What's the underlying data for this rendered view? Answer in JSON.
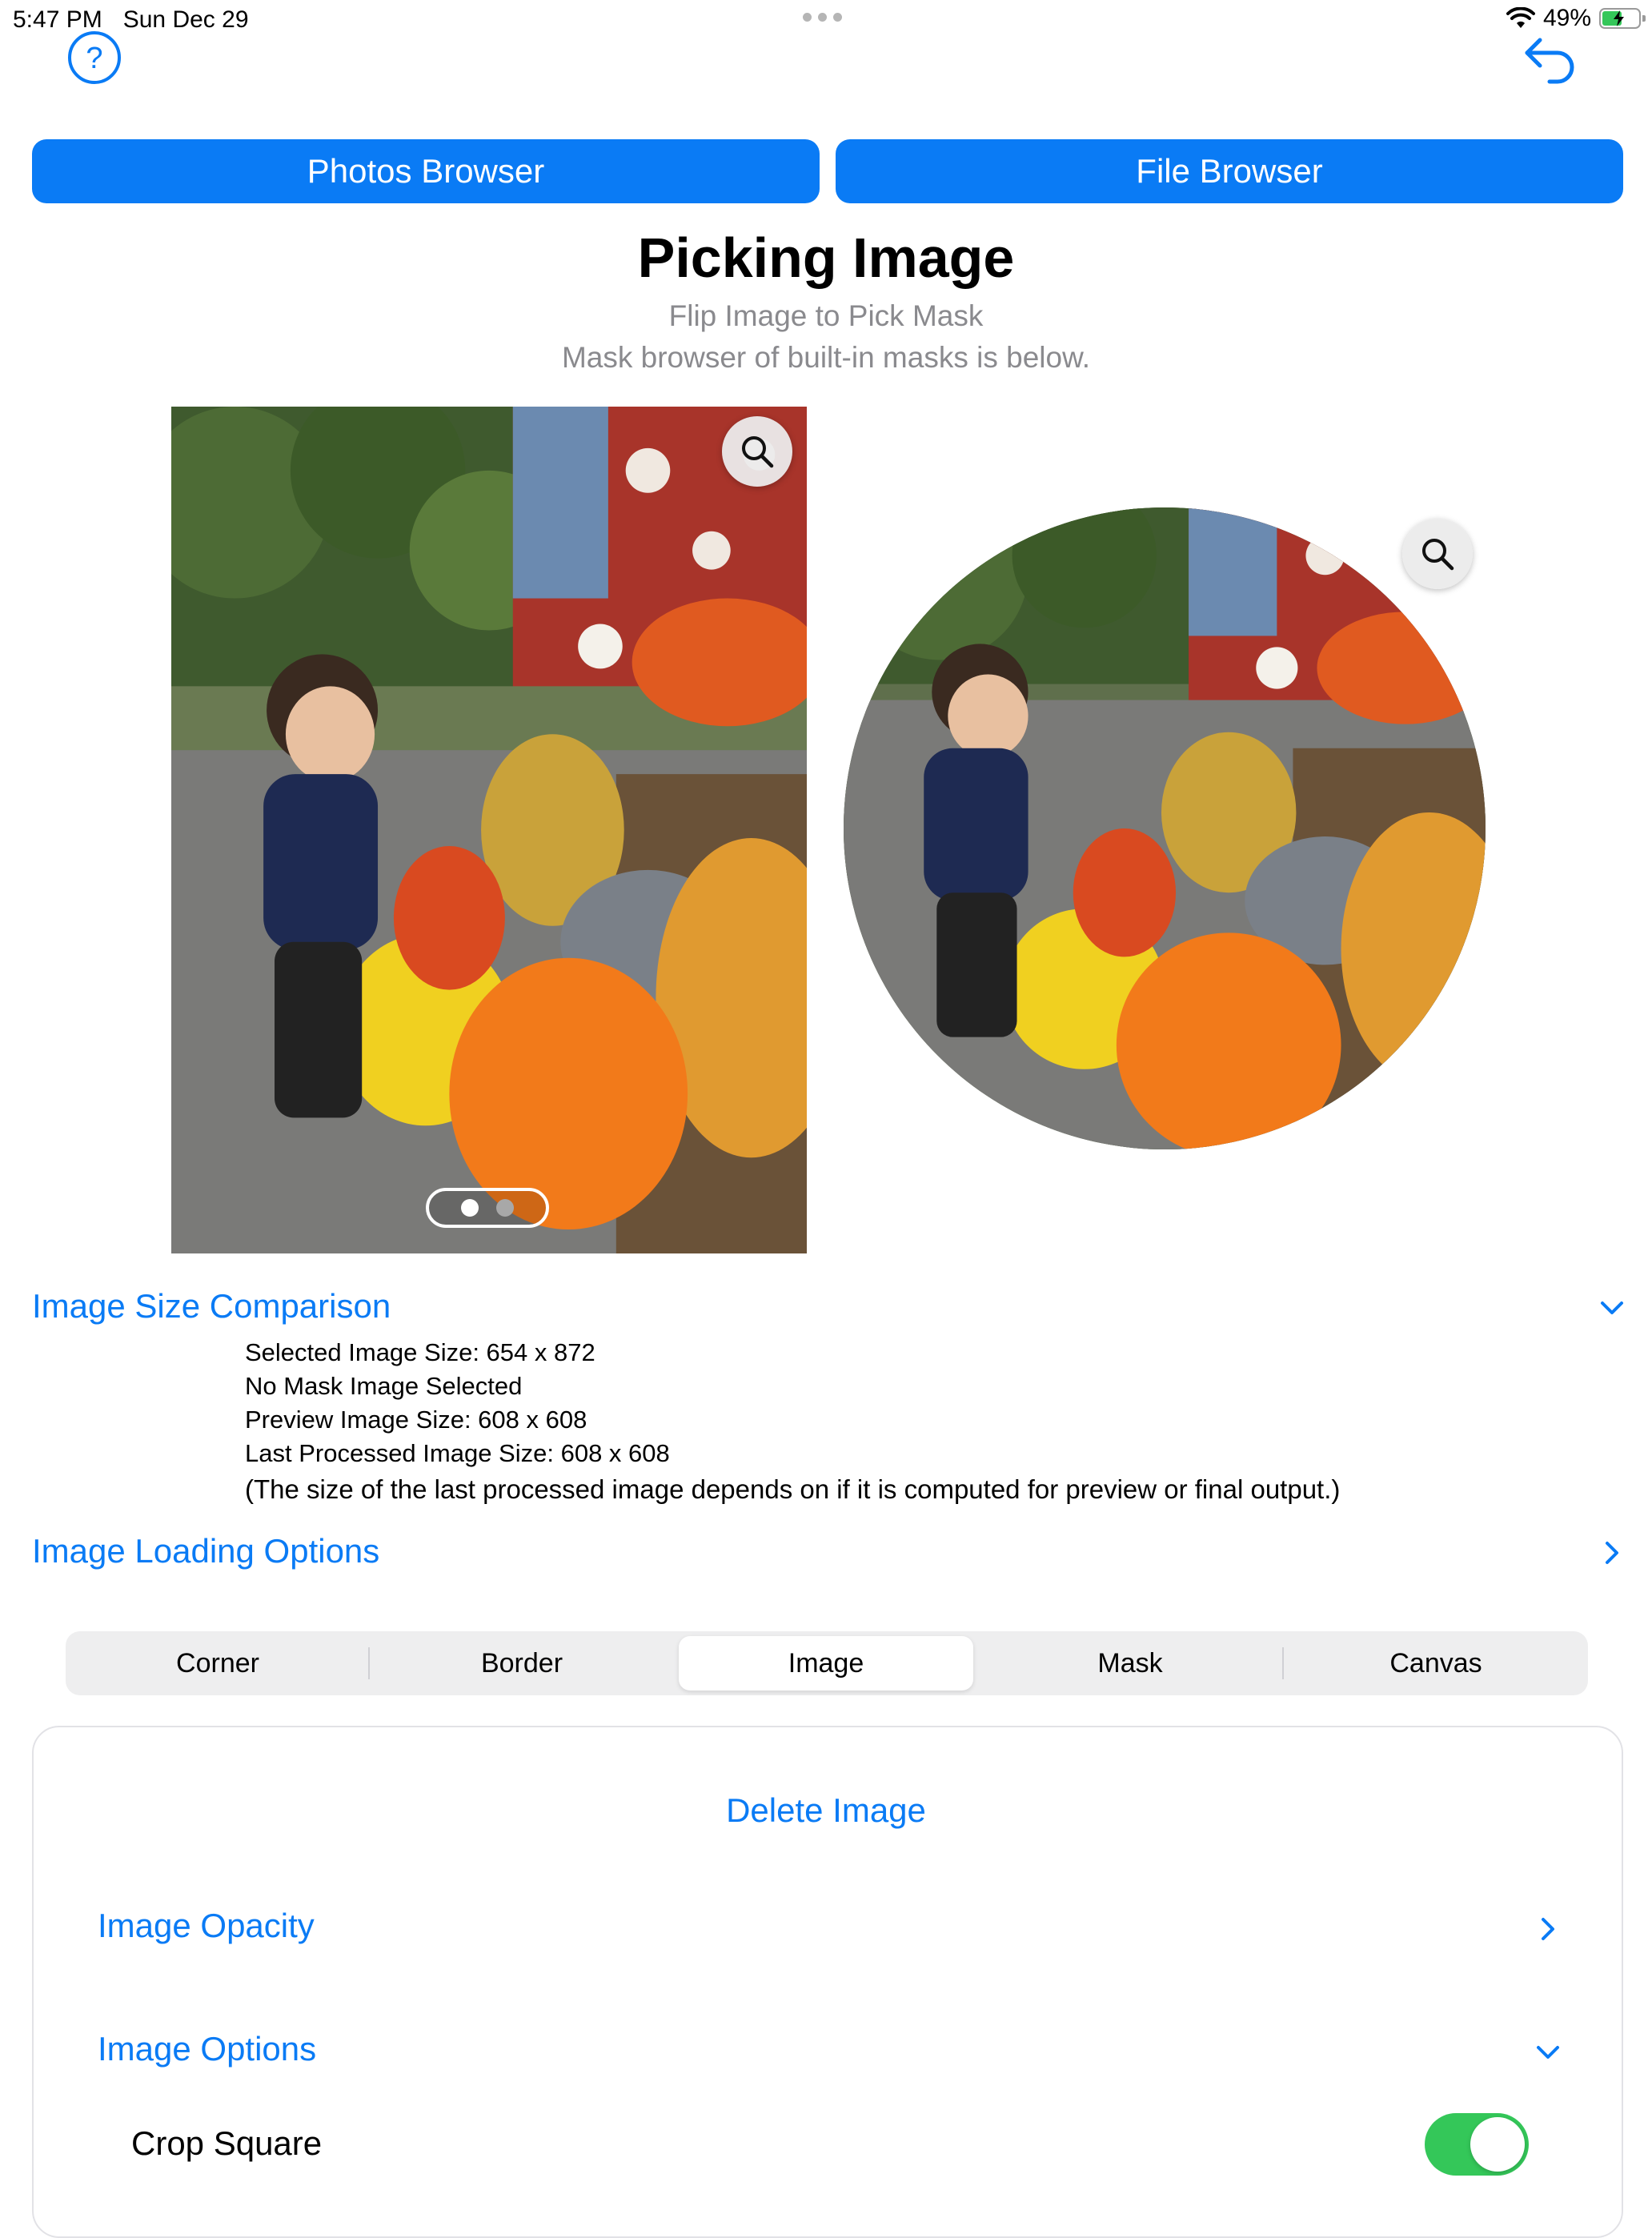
{
  "status_bar": {
    "time": "5:47 PM",
    "date": "Sun Dec 29",
    "battery": "49%",
    "battery_level": 0.49,
    "charging": true
  },
  "toolbar": {
    "help_icon": "question-circle-icon",
    "undo_icon": "undo-arrow-icon"
  },
  "buttons": {
    "photos_browser": "Photos Browser",
    "file_browser": "File Browser"
  },
  "header": {
    "title": "Picking Image",
    "subtitle_1": "Flip Image to Pick Mask",
    "subtitle_2": "Mask browser of built-in masks is below."
  },
  "preview": {
    "page_count": 2,
    "current_page": 1
  },
  "size_comparison": {
    "title": "Image Size Comparison",
    "expanded": true,
    "lines": [
      "Selected Image Size: 654 x 872",
      "No Mask Image Selected",
      "Preview Image Size: 608 x 608",
      "Last Processed Image Size: 608 x 608"
    ],
    "note": "(The size of the last processed image depends on if it is computed for preview or final output.)"
  },
  "loading_options": {
    "title": "Image Loading Options",
    "expanded": false
  },
  "segments": {
    "items": [
      "Corner",
      "Border",
      "Image",
      "Mask",
      "Canvas"
    ],
    "selected": "Image"
  },
  "image_panel": {
    "delete": "Delete Image",
    "opacity": "Image Opacity",
    "options": "Image Options",
    "crop_square": "Crop Square",
    "crop_square_on": true
  },
  "colors": {
    "accent": "#0a7bf5",
    "toggle_on": "#34c759",
    "secondary_text": "#8a8a8e"
  }
}
